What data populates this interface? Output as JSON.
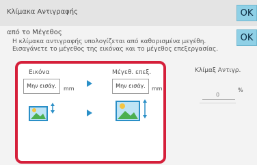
{
  "header": {
    "title": "Κλίμακα Αντιγραφής",
    "ok_label": "OK"
  },
  "panel": {
    "title": "από το Μέγεθος",
    "ok_label": "OK",
    "description_line1": "Η κλίμακα αντιγραφής υπολογίζεται από καθορισμένα μεγέθη.",
    "description_line2": "Εισαγάνετε το μέγεθος της εικόνας και το μέγεθος επεξεργασίας."
  },
  "original": {
    "label": "Εικόνα",
    "placeholder": "Μην εισάγ.",
    "unit": "mm"
  },
  "output": {
    "label": "Μέγεθ. επεξ.",
    "placeholder": "Μην εισάγ.",
    "unit": "mm"
  },
  "ratio": {
    "label": "Κλίμαξ Αντιγρ.",
    "value": "0",
    "unit": "%"
  },
  "colors": {
    "highlight": "#d51f3a",
    "accent": "#2a8fc7",
    "ok_button": "#8fd0e6"
  }
}
